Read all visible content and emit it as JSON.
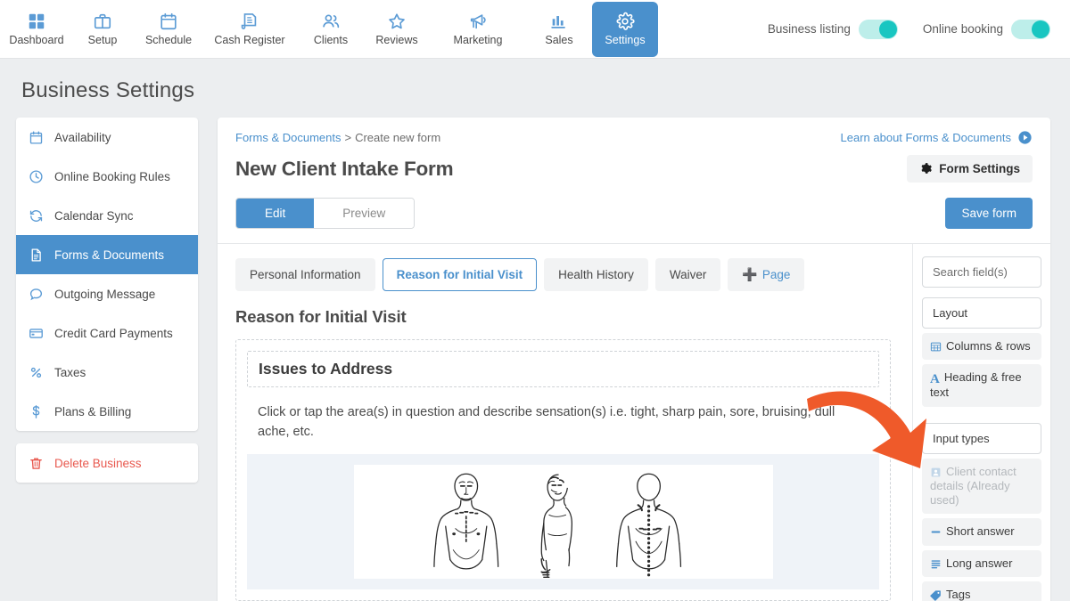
{
  "topnav": {
    "items": [
      {
        "label": "Dashboard",
        "icon": "grid-icon",
        "active": false
      },
      {
        "label": "Setup",
        "icon": "briefcase-icon",
        "active": false
      },
      {
        "label": "Schedule",
        "icon": "calendar-icon",
        "active": false
      },
      {
        "label": "Cash Register",
        "icon": "receipt-icon",
        "active": false
      },
      {
        "label": "Clients",
        "icon": "people-icon",
        "active": false
      },
      {
        "label": "Reviews",
        "icon": "star-icon",
        "active": false
      },
      {
        "label": "Marketing",
        "icon": "megaphone-icon",
        "active": false
      },
      {
        "label": "Sales",
        "icon": "bar-chart-icon",
        "active": false
      },
      {
        "label": "Settings",
        "icon": "gear-icon",
        "active": true
      }
    ],
    "toggles": [
      {
        "label": "Business listing",
        "on": true
      },
      {
        "label": "Online booking",
        "on": true
      }
    ]
  },
  "page": {
    "title": "Business Settings"
  },
  "sidebar": {
    "items": [
      {
        "label": "Availability",
        "icon": "calendar-icon",
        "active": false
      },
      {
        "label": "Online Booking Rules",
        "icon": "clock-icon",
        "active": false
      },
      {
        "label": "Calendar Sync",
        "icon": "sync-icon",
        "active": false
      },
      {
        "label": "Forms & Documents",
        "icon": "document-icon",
        "active": true
      },
      {
        "label": "Outgoing Message",
        "icon": "chat-bubble-icon",
        "active": false
      },
      {
        "label": "Credit Card Payments",
        "icon": "credit-card-icon",
        "active": false
      },
      {
        "label": "Taxes",
        "icon": "percent-icon",
        "active": false
      },
      {
        "label": "Plans & Billing",
        "icon": "dollar-icon",
        "active": false
      }
    ],
    "danger": {
      "label": "Delete Business",
      "icon": "trash-icon"
    }
  },
  "breadcrumb": {
    "root": "Forms & Documents",
    "separator": ">",
    "current": "Create new form"
  },
  "learn_link": {
    "label": "Learn about Forms & Documents",
    "icon": "play-circle-icon"
  },
  "form": {
    "title": "New Client Intake Form",
    "settings_button": "Form Settings",
    "modes": [
      {
        "label": "Edit",
        "active": true
      },
      {
        "label": "Preview",
        "active": false
      }
    ],
    "save_button": "Save form"
  },
  "page_tabs": [
    {
      "label": "Personal Information",
      "active": false
    },
    {
      "label": "Reason for Initial Visit",
      "active": true
    },
    {
      "label": "Health History",
      "active": false
    },
    {
      "label": "Waiver",
      "active": false
    }
  ],
  "add_page_button": {
    "label": "Page",
    "icon": "plus-icon"
  },
  "editor": {
    "section_heading": "Reason for Initial Visit",
    "block_heading": "Issues to Address",
    "block_text": "Click or tap the area(s) in question and describe sensation(s) i.e. tight, sharp pain, sore, bruising, dull ache, etc.",
    "image_alt": "body-diagram-front-side-back"
  },
  "field_rail": {
    "search_placeholder": "Search field(s)",
    "groups": [
      {
        "name": "Layout",
        "items": [
          {
            "label": "Columns & rows",
            "icon": "table-icon",
            "disabled": false
          },
          {
            "label": "Heading & free text",
            "icon": "letter-a-icon",
            "disabled": false
          }
        ]
      },
      {
        "name": "Input types",
        "items": [
          {
            "label": "Client contact details (Already used)",
            "icon": "contact-card-icon",
            "disabled": true
          },
          {
            "label": "Short answer",
            "icon": "minus-icon",
            "disabled": false
          },
          {
            "label": "Long answer",
            "icon": "lines-icon",
            "disabled": false
          },
          {
            "label": "Tags",
            "icon": "tag-icon",
            "disabled": false
          }
        ]
      }
    ]
  },
  "annotation": {
    "type": "curved-arrow",
    "color": "#ef5a2a",
    "points_to": "Columns & rows"
  },
  "colors": {
    "accent_blue": "#4a90cc",
    "toggle_teal": "#19c6c1",
    "danger_red": "#e8584e",
    "annotation_orange": "#ef5a2a",
    "page_bg": "#eceef0"
  }
}
